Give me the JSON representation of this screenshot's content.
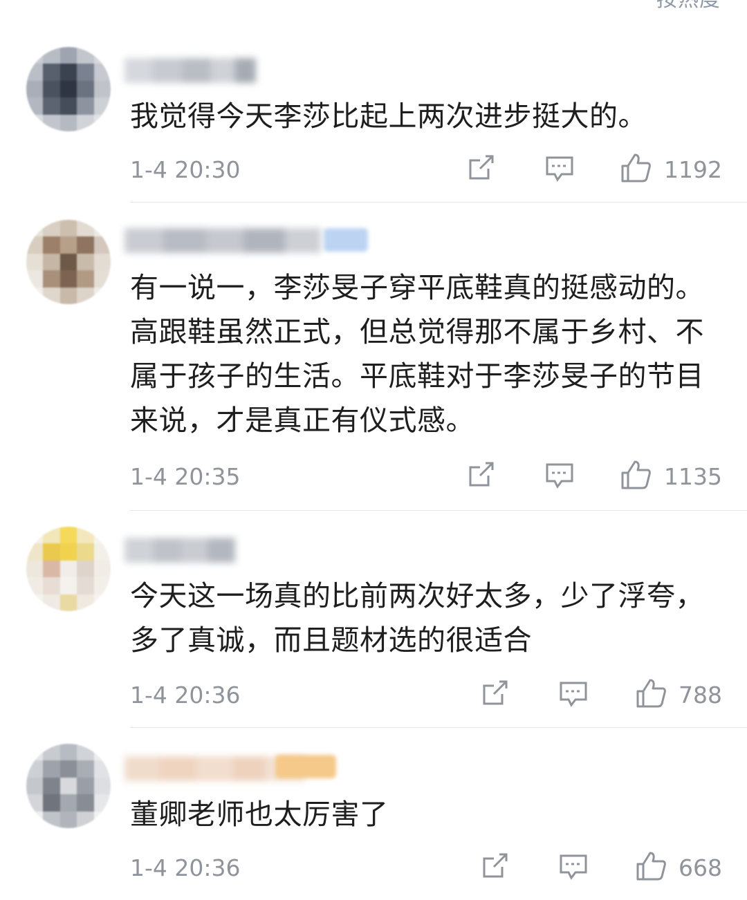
{
  "sort_label": "按热度",
  "colors": {
    "text": "#1e1e1e",
    "meta": "#8f939a",
    "divider": "#e6e6e6"
  },
  "icons": {
    "repost": "share-out-icon",
    "comment": "comment-bubble-icon",
    "like": "thumb-up-icon"
  },
  "comments": [
    {
      "text": "我觉得今天李莎比起上两次进步挺大的。",
      "time": "1-4 20:30",
      "likes": "1192"
    },
    {
      "text": "有一说一，李莎旻子穿平底鞋真的挺感动的。高跟鞋虽然正式，但总觉得那不属于乡村、不属于孩子的生活。平底鞋对于李莎旻子的节目来说，才是真正有仪式感。",
      "time": "1-4 20:35",
      "likes": "1135"
    },
    {
      "text": "今天这一场真的比前两次好太多，少了浮夸，多了真诚，而且题材选的很适合",
      "time": "1-4 20:36",
      "likes": "788"
    },
    {
      "text": "董卿老师也太厉害了",
      "time": "1-4 20:36",
      "likes": "668"
    }
  ]
}
